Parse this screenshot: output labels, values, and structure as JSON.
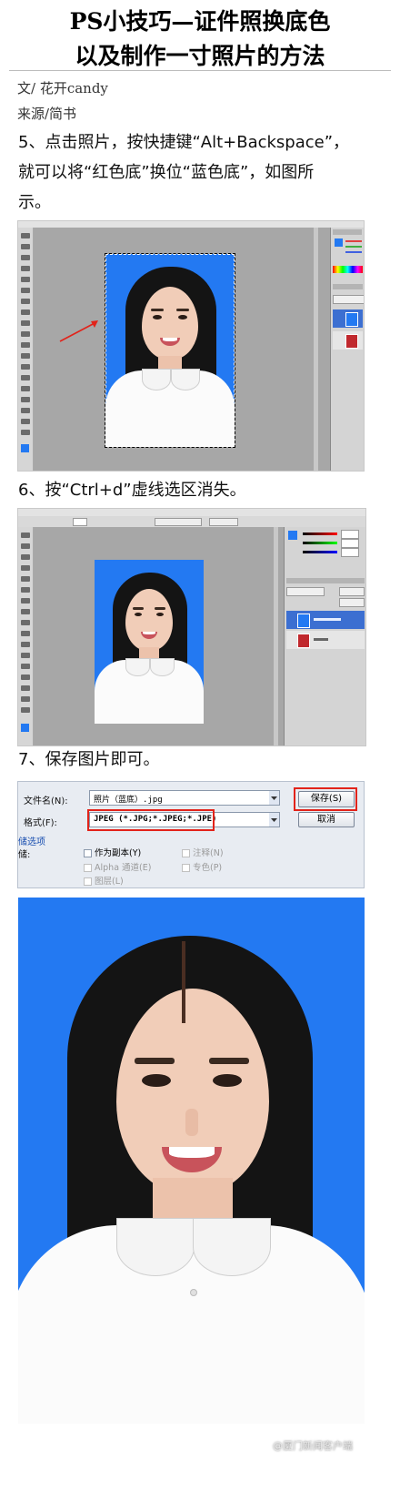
{
  "article": {
    "title_line1": "PS小技巧—证件照换底色",
    "title_line2": "以及制作一寸照片的方法",
    "author": "文/ 花开candy",
    "source": "来源/简书"
  },
  "steps": {
    "step5_line1": "5、点击照片，按快捷键“Alt+Backspace”，",
    "step5_line2": "就可以将“红色底”换位“蓝色底”，如图所",
    "step5_line3": "示。",
    "step6": "6、按“Ctrl+d”虚线选区消失。",
    "step7": "7、保存图片即可。"
  },
  "save_dialog": {
    "filename_label": "文件名(N):",
    "filename_value": "照片（蓝底）.jpg",
    "format_label": "格式(F):",
    "format_value": "JPEG (*.JPG;*.JPEG;*.JPE)",
    "save_button": "保存(S)",
    "cancel_button": "取消",
    "section_label": "储选项",
    "storage_label": "储:",
    "options": [
      {
        "label": "作为副本(Y)",
        "enabled": true
      },
      {
        "label": "注释(N)",
        "enabled": false
      },
      {
        "label": "Alpha 通道(E)",
        "enabled": false
      },
      {
        "label": "专色(P)",
        "enabled": false
      },
      {
        "label": "图层(L)",
        "enabled": false
      }
    ]
  },
  "watermark": "@厦门新闻客户端",
  "colors": {
    "background_blue": "#2379f2",
    "highlight_red": "#e2231a"
  }
}
